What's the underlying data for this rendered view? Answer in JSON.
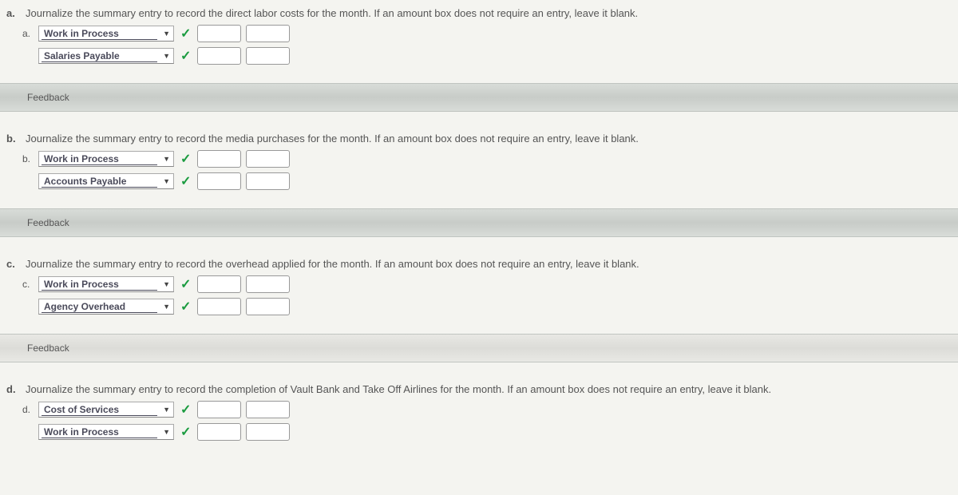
{
  "questions": {
    "a": {
      "letter": "a.",
      "prompt": "Journalize the summary entry to record the direct labor costs for the month. If an amount box does not require an entry, leave it blank.",
      "row_letter": "a.",
      "account1": "Work in Process",
      "account2": "Salaries Payable",
      "feedback_label": "Feedback"
    },
    "b": {
      "letter": "b.",
      "prompt": "Journalize the summary entry to record the media purchases for the month. If an amount box does not require an entry, leave it blank.",
      "row_letter": "b.",
      "account1": "Work in Process",
      "account2": "Accounts Payable",
      "feedback_label": "Feedback"
    },
    "c": {
      "letter": "c.",
      "prompt": "Journalize the summary entry to record the overhead applied for the month. If an amount box does not require an entry, leave it blank.",
      "row_letter": "c.",
      "account1": "Work in Process",
      "account2": "Agency Overhead",
      "feedback_label": "Feedback"
    },
    "d": {
      "letter": "d.",
      "prompt": "Journalize the summary entry to record the completion of Vault Bank and Take Off Airlines for the month. If an amount box does not require an entry, leave it blank.",
      "row_letter": "d.",
      "account1": "Cost of Services",
      "account2": "Work in Process"
    }
  }
}
